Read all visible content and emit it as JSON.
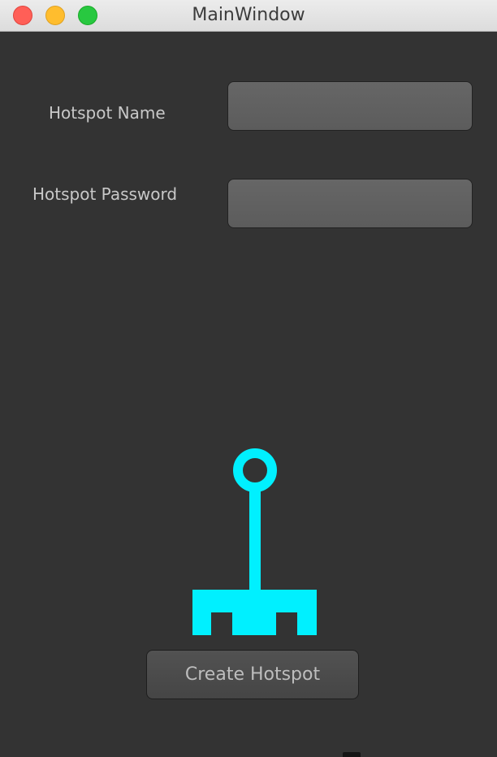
{
  "window": {
    "title": "MainWindow"
  },
  "form": {
    "hotspot_name_label": "Hotspot Name",
    "hotspot_name_value": "",
    "hotspot_password_label": "Hotspot Password",
    "hotspot_password_value": ""
  },
  "logo": {
    "icon": "hotspot-antenna-icon",
    "color": "#00f0ff"
  },
  "actions": {
    "create_label": "Create Hotspot"
  },
  "colors": {
    "background": "#333333",
    "field": "#636363",
    "label_text": "#c8c8c8"
  }
}
